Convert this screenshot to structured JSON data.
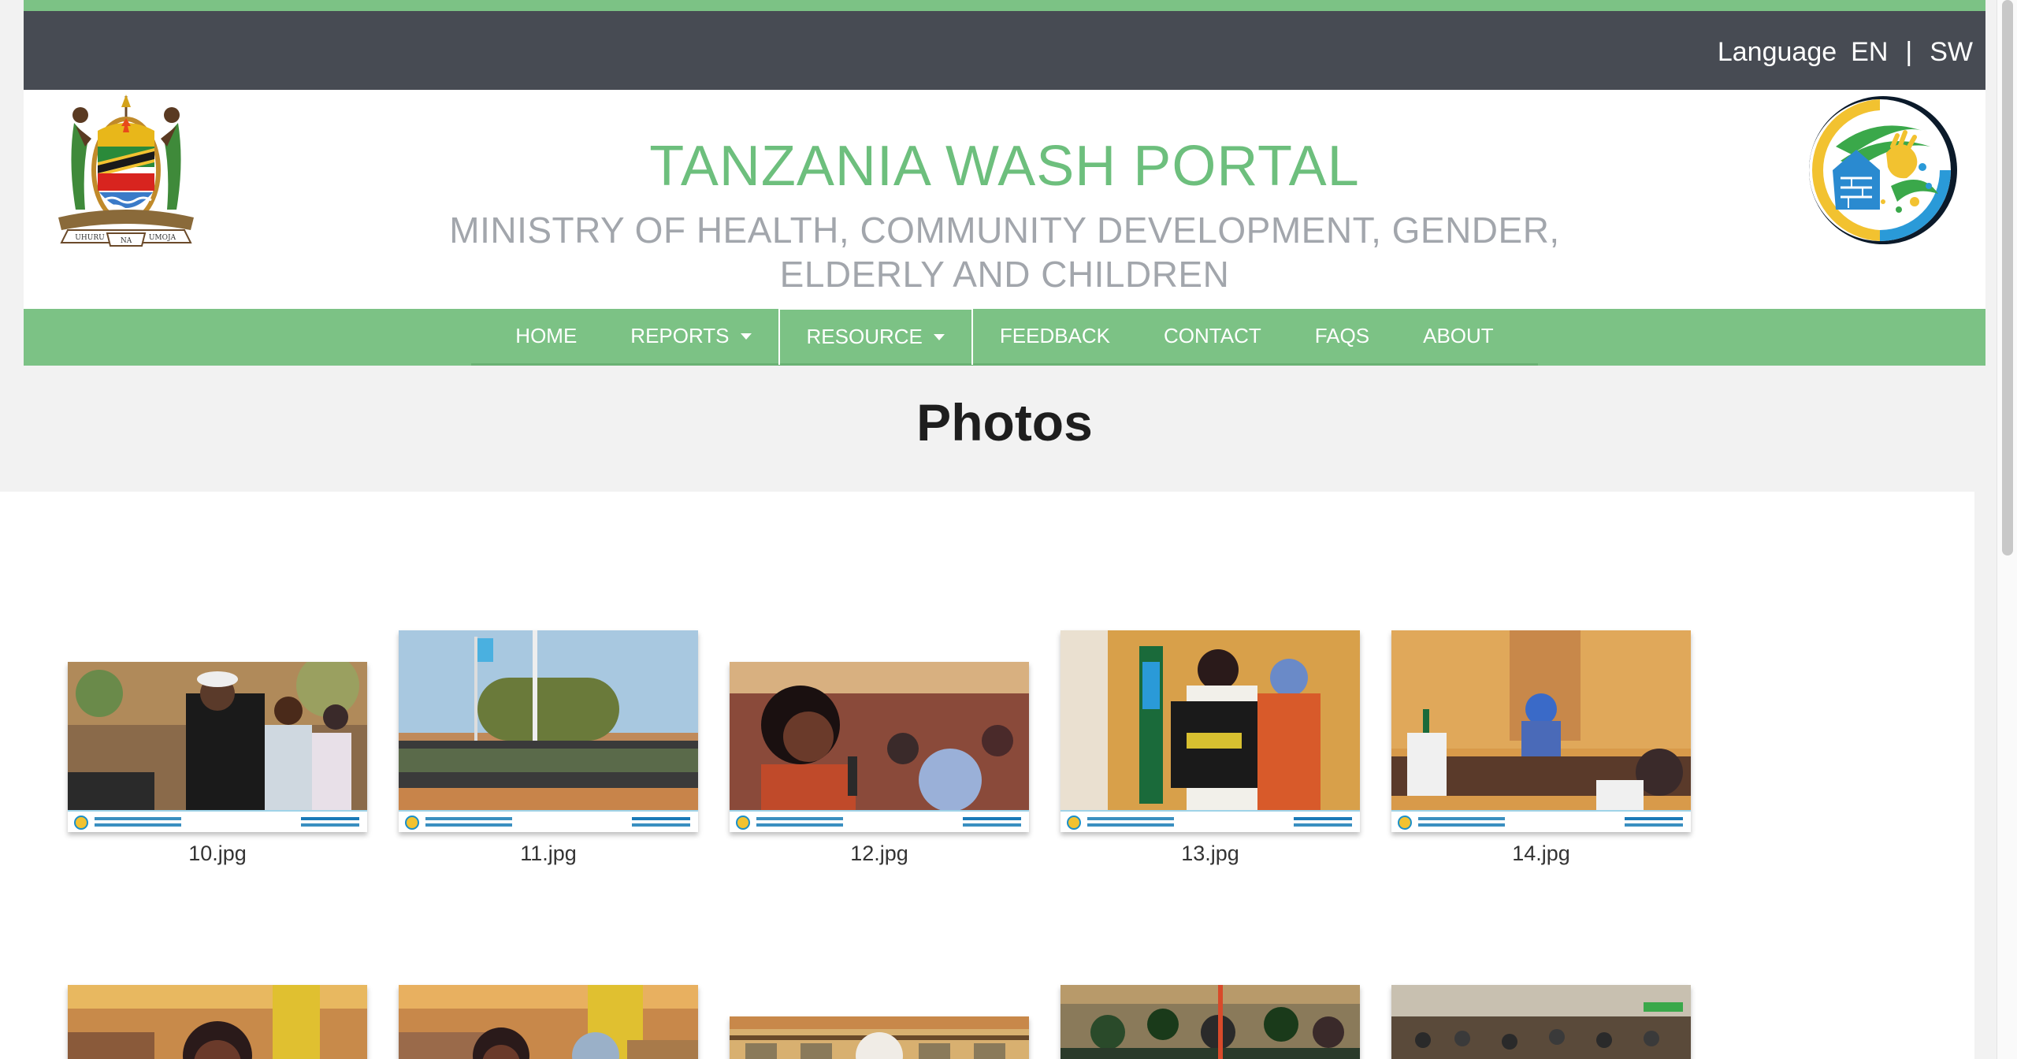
{
  "language": {
    "label": "Language",
    "options": [
      "EN",
      "SW"
    ],
    "separator": "|"
  },
  "header": {
    "title": "TANZANIA WASH PORTAL",
    "subtitle": "MINISTRY OF HEALTH, COMMUNITY DEVELOPMENT, GENDER, ELDERLY AND CHILDREN",
    "coat_of_arms_motto": [
      "UHURU",
      "NA",
      "UMOJA"
    ]
  },
  "nav": {
    "items": [
      {
        "label": "HOME",
        "dropdown": false,
        "active": false
      },
      {
        "label": "REPORTS",
        "dropdown": true,
        "active": false
      },
      {
        "label": "RESOURCE",
        "dropdown": true,
        "active": true
      },
      {
        "label": "FEEDBACK",
        "dropdown": false,
        "active": false
      },
      {
        "label": "CONTACT",
        "dropdown": false,
        "active": false
      },
      {
        "label": "FAQS",
        "dropdown": false,
        "active": false
      },
      {
        "label": "ABOUT",
        "dropdown": false,
        "active": false
      }
    ]
  },
  "page": {
    "title": "Photos"
  },
  "photos": [
    {
      "caption": "10.jpg",
      "scene": "man speaking into microphone"
    },
    {
      "caption": "11.jpg",
      "scene": "group standing in field under sky"
    },
    {
      "caption": "12.jpg",
      "scene": "woman speaking at event"
    },
    {
      "caption": "13.jpg",
      "scene": "two women holding t-shirt"
    },
    {
      "caption": "14.jpg",
      "scene": "woman seated at office desk"
    },
    {
      "caption": "",
      "scene": "woman at table"
    },
    {
      "caption": "",
      "scene": "people seated at event"
    },
    {
      "caption": "",
      "scene": "building exterior"
    },
    {
      "caption": "",
      "scene": "crowd of officials"
    },
    {
      "caption": "",
      "scene": "outdoor crowd"
    }
  ],
  "colors": {
    "green": "#7cc285",
    "dark_bar": "#474b53",
    "title_green": "#6dbf7d",
    "subtitle_gray": "#a2a6ac"
  }
}
